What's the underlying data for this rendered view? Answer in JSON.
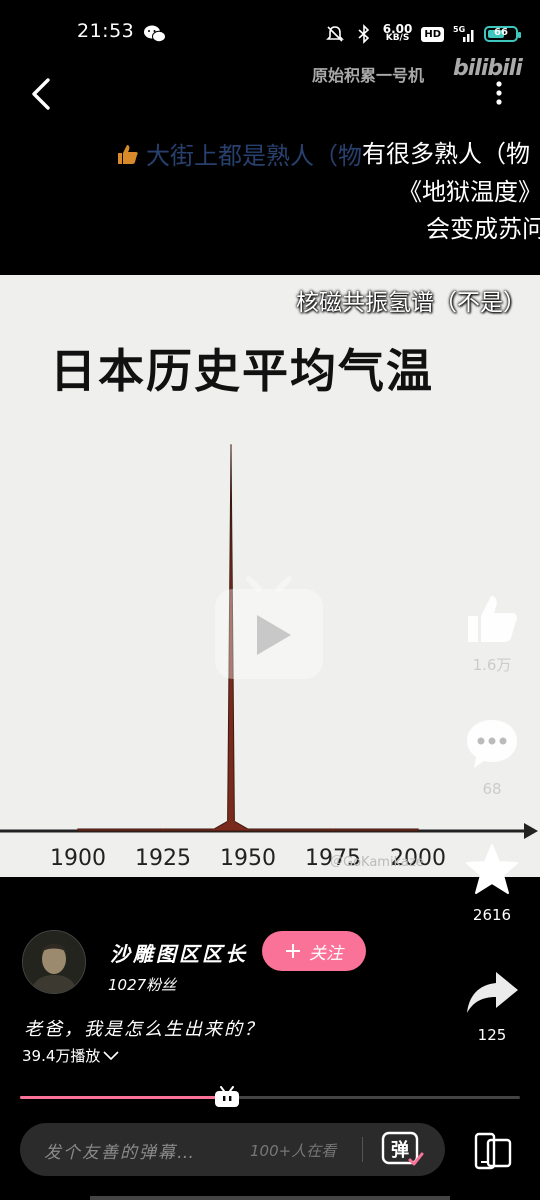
{
  "status_bar": {
    "time": "21:53",
    "net_speed_value": "6.00",
    "net_speed_unit": "KB/S",
    "hd": "HD",
    "network": "5G",
    "battery": "66"
  },
  "header": {
    "channel": "原始积累一号机",
    "logo_text": "bilibili"
  },
  "danmaku": [
    "大街上都是熟人（物",
    "有很多熟人（物",
    "《地狱温度》",
    "会变成苏问"
  ],
  "video": {
    "subtitle": "核磁共振氢谱（不是）",
    "title": "日本历史平均气温",
    "watermark": "＠GoKamikaze",
    "x_ticks": [
      "1900",
      "1925",
      "1950",
      "1975",
      "2000"
    ]
  },
  "chart_data": {
    "type": "line",
    "title": "日本历史平均气温",
    "x": [
      1900,
      1925,
      1940,
      1944,
      1945,
      1946,
      1950,
      1975,
      2000
    ],
    "xlabel": "",
    "ylabel": "",
    "xlim": [
      1890,
      2005
    ],
    "series": [
      {
        "values": [
          0,
          0,
          0,
          2,
          100,
          2,
          0,
          0,
          0
        ]
      }
    ]
  },
  "actions": {
    "like_count": "1.6万",
    "comment_count": "68",
    "favorite_count": "2616",
    "share_count": "125"
  },
  "author": {
    "name": "沙雕图区区长",
    "follow_label": "关注",
    "fans": "1027粉丝"
  },
  "description": "老爸，我是怎么生出来的？",
  "play_count": "39.4万播放",
  "progress": 0.41,
  "danmaku_bar": {
    "placeholder": "发个友善的弹幕…",
    "viewers": "100+人在看",
    "toggle_label": "弹"
  },
  "colors": {
    "accent": "#fb7299",
    "battery": "#3fc7bd",
    "spike": "#7a2a1c"
  }
}
